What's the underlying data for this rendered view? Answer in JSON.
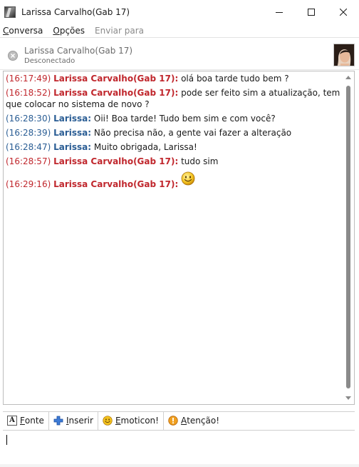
{
  "window": {
    "title": "Larissa Carvalho(Gab 17)",
    "minimize_icon": "minimize-icon",
    "maximize_icon": "maximize-icon",
    "close_icon": "close-icon"
  },
  "menu": {
    "items": [
      {
        "label": "Conversa",
        "underline": "C",
        "rest": "onversa",
        "enabled": true
      },
      {
        "label": "Opções",
        "underline": "O",
        "rest": "pções",
        "enabled": true
      },
      {
        "label": "Enviar para",
        "underline": "",
        "rest": "Enviar para",
        "enabled": false
      }
    ]
  },
  "contact": {
    "name": "Larissa Carvalho(Gab 17)",
    "status": "Desconectado",
    "status_icon": "offline-icon"
  },
  "messages": [
    {
      "time": "(16:17:49)",
      "sender": "Larissa Carvalho(Gab 17):",
      "text": "olá boa tarde tudo bem ?",
      "from": "remote"
    },
    {
      "time": "(16:18:52)",
      "sender": "Larissa Carvalho(Gab 17):",
      "text": "pode ser feito sim a atualização, tem que colocar no sistema de novo ?",
      "from": "remote"
    },
    {
      "time": "(16:28:30)",
      "sender": "Larissa:",
      "text": "Oii! Boa tarde! Tudo bem sim e com você?",
      "from": "local"
    },
    {
      "time": "(16:28:39)",
      "sender": "Larissa:",
      "text": "Não precisa não, a gente vai fazer a alteração",
      "from": "local"
    },
    {
      "time": "(16:28:47)",
      "sender": "Larissa:",
      "text": "Muito obrigada, Larissa!",
      "from": "local"
    },
    {
      "time": "(16:28:57)",
      "sender": "Larissa Carvalho(Gab 17):",
      "text": "tudo sim",
      "from": "remote"
    },
    {
      "time": "(16:29:16)",
      "sender": "Larissa Carvalho(Gab 17):",
      "text": "",
      "from": "remote",
      "emoticon": "smiley-icon"
    }
  ],
  "toolbar": {
    "font": {
      "u": "F",
      "rest": "onte",
      "icon": "font-icon"
    },
    "insert": {
      "u": "I",
      "rest": "nserir",
      "icon": "plus-icon"
    },
    "emoticon": {
      "u": "E",
      "rest": "moticon!",
      "icon": "smiley-icon"
    },
    "attention": {
      "u": "A",
      "rest": "tenção!",
      "icon": "warning-icon"
    }
  },
  "input": {
    "value": ""
  },
  "colors": {
    "remote": "#c0272d",
    "local": "#2a5d94"
  }
}
